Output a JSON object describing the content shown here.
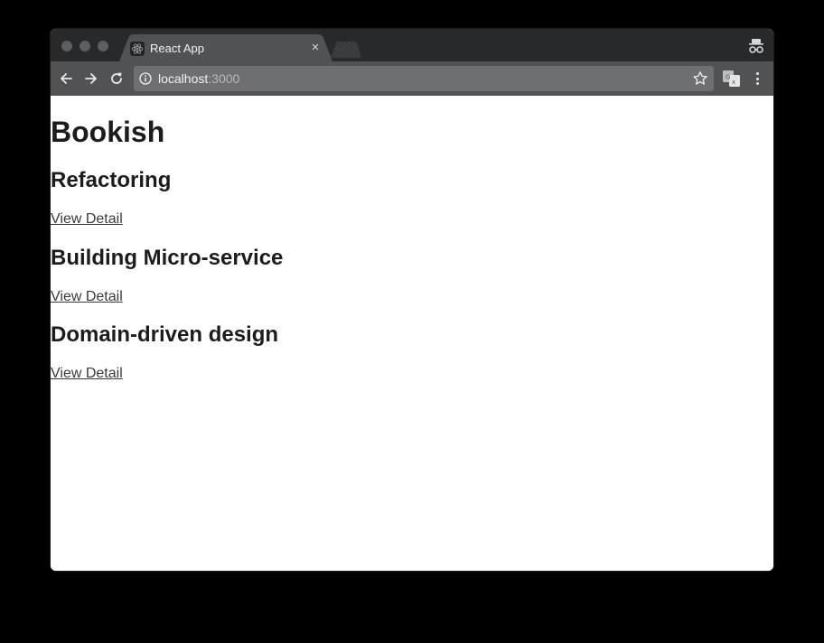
{
  "browser": {
    "tab_title": "React App",
    "tab_close": "×",
    "url_host": "localhost",
    "url_port": ":3000"
  },
  "icons": {
    "favicon": "react-atom-icon",
    "back": "arrow-left-icon",
    "forward": "arrow-right-icon",
    "reload": "reload-icon",
    "info": "info-icon",
    "bookmark": "star-icon",
    "translate": "translate-icon",
    "menu": "kebab-menu-icon",
    "incognito": "incognito-icon"
  },
  "page": {
    "title": "Bookish",
    "books": [
      {
        "title": "Refactoring",
        "link_label": "View Detail"
      },
      {
        "title": "Building Micro-service",
        "link_label": "View Detail"
      },
      {
        "title": "Domain-driven design",
        "link_label": "View Detail"
      }
    ]
  },
  "colors": {
    "titlebar": "#27292b",
    "toolbar": "#505254",
    "omnibox": "#6d6f71",
    "page_background": "#ffffff",
    "text": "#1c1c1c"
  }
}
